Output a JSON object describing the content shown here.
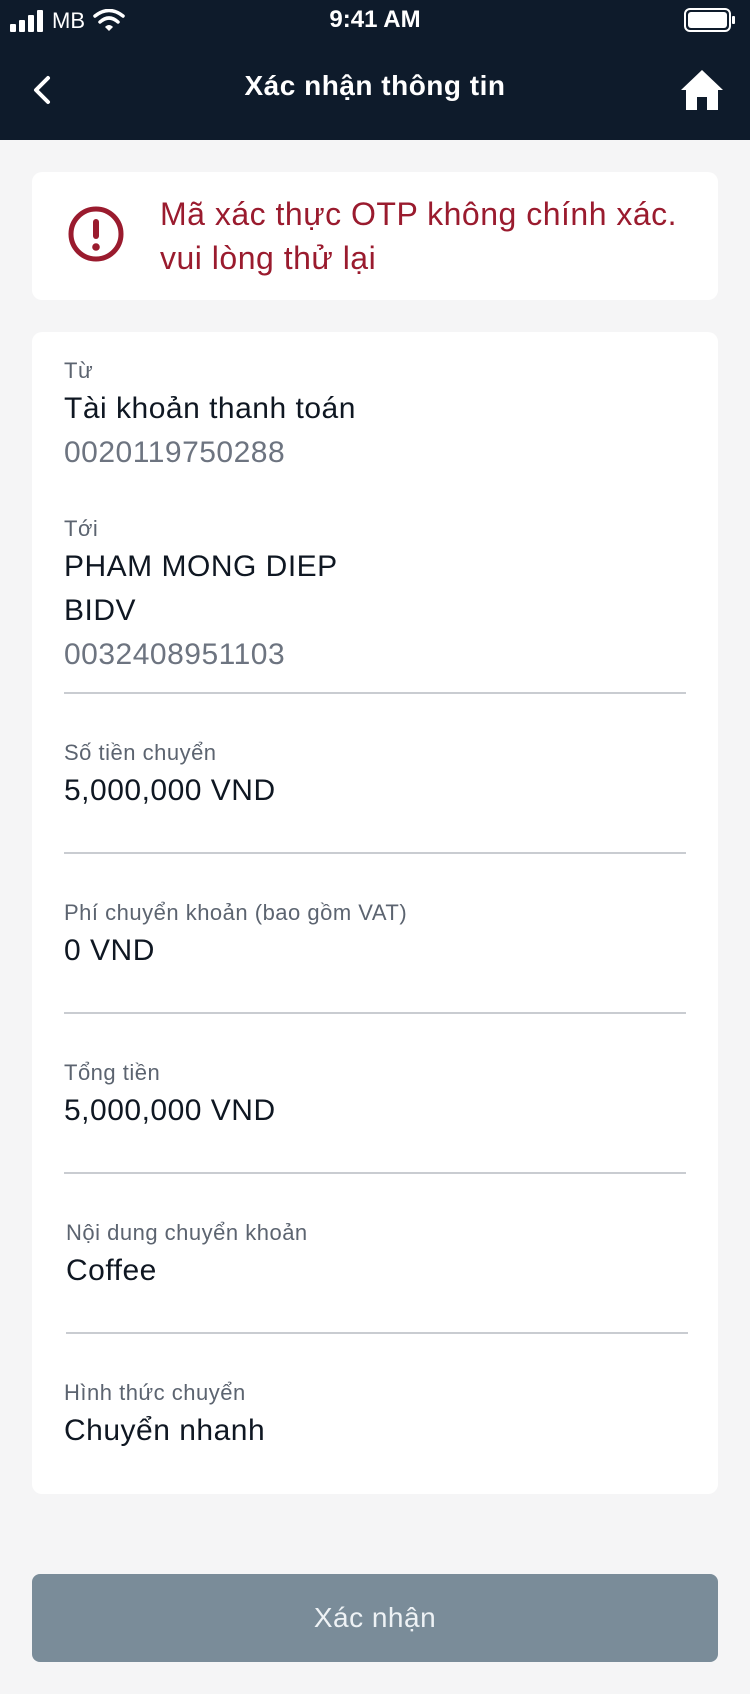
{
  "status_bar": {
    "carrier": "MB",
    "time": "9:41 AM"
  },
  "header": {
    "title": "Xác nhận thông tin"
  },
  "error": {
    "message": "Mã xác thực OTP không chính xác. vui lòng thử lại",
    "color": "#9a1b2e"
  },
  "from": {
    "label": "Từ",
    "account_name": "Tài khoản thanh toán",
    "account_number": "0020119750288"
  },
  "to": {
    "label": "Tới",
    "name": "PHAM MONG DIEP",
    "bank": "BIDV",
    "account_number": "0032408951103"
  },
  "amount": {
    "label": "Số tiền chuyển",
    "value": "5,000,000 VND"
  },
  "fee": {
    "label": "Phí chuyển khoản (bao gồm VAT)",
    "value": "0 VND"
  },
  "total": {
    "label": "Tổng tiền",
    "value": "5,000,000 VND"
  },
  "content": {
    "label": "Nội dung chuyển khoản",
    "value": "Coffee"
  },
  "method": {
    "label": "Hình thức chuyển",
    "value": "Chuyển nhanh"
  },
  "confirm_button": {
    "label": "Xác nhận"
  }
}
